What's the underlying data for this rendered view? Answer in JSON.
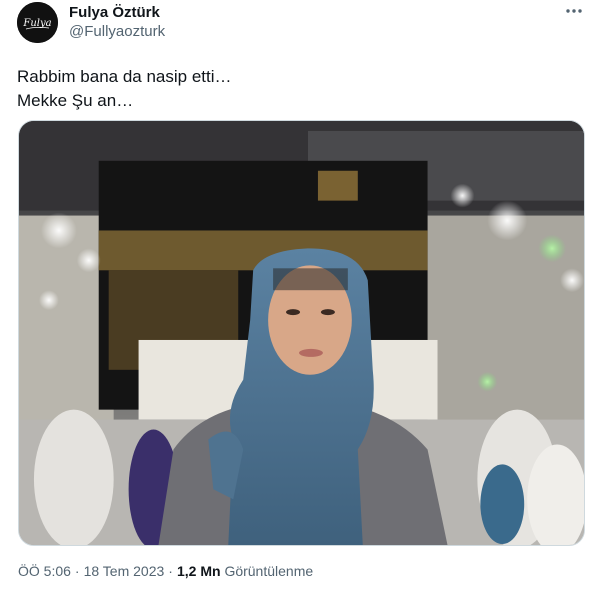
{
  "author": {
    "name": "Fulya Öztürk",
    "handle": "@Fullyaozturk",
    "avatar_text": "Fulya",
    "avatar_icon": "signature-logo"
  },
  "more_icon": "ellipsis-icon",
  "tweet": {
    "lines": [
      "Rabbim bana da nasip etti…",
      "Mekke Şu an…"
    ]
  },
  "media": {
    "alt": "woman in blue headscarf in front of the Kaaba"
  },
  "meta": {
    "time": "ÖÖ 5:06",
    "date": "18 Tem 2023",
    "views_count": "1,2 Mn",
    "views_label": "Görüntülenme",
    "separator": "·"
  },
  "colors": {
    "text": "#0f1419",
    "secondary": "#536471",
    "border": "#cfd9de",
    "headscarf": "#4f7390"
  }
}
